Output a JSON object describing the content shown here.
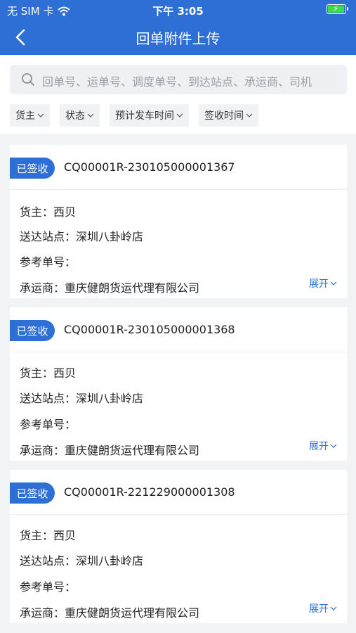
{
  "status_bar": {
    "carrier": "无 SIM 卡",
    "time": "下午 3:05",
    "battery_level": 1.0
  },
  "nav": {
    "title": "回单附件上传"
  },
  "search": {
    "placeholder": "回单号、运单号、调度单号、到达站点、承运商、司机"
  },
  "filters": [
    {
      "label": "货主"
    },
    {
      "label": "状态"
    },
    {
      "label": "预计发车时间"
    },
    {
      "label": "签收时间"
    }
  ],
  "cards": [
    {
      "status": "已签收",
      "order_no": "CQ00001R-230105000001367",
      "owner": "货主：西贝",
      "station": "送达站点：深圳八卦岭店",
      "ref_no": "参考单号：",
      "carrier": "承运商：重庆健朗货运代理有限公司",
      "expand": "展开"
    },
    {
      "status": "已签收",
      "order_no": "CQ00001R-230105000001368",
      "owner": "货主：西贝",
      "station": "送达站点：深圳八卦岭店",
      "ref_no": "参考单号：",
      "carrier": "承运商：重庆健朗货运代理有限公司",
      "expand": "展开"
    },
    {
      "status": "已签收",
      "order_no": "CQ00001R-221229000001308",
      "owner": "货主：西贝",
      "station": "送达站点：深圳八卦岭店",
      "ref_no": "参考单号：",
      "carrier": "承运商：重庆健朗货运代理有限公司",
      "expand": "展开"
    }
  ],
  "colors": {
    "primary": "#2e6fd6",
    "battery": "#3ddc4a"
  }
}
